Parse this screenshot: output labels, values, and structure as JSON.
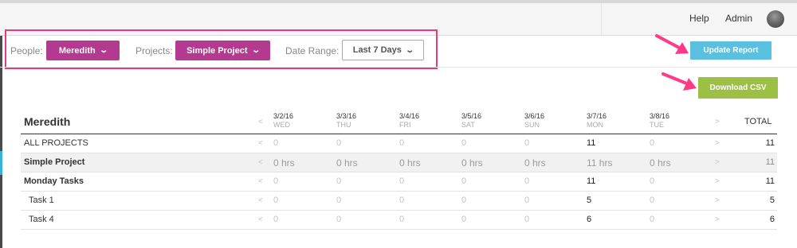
{
  "header": {
    "help": "Help",
    "admin": "Admin"
  },
  "filters": {
    "people_label": "People:",
    "people_value": "Meredith",
    "projects_label": "Projects:",
    "projects_value": "Simple Project",
    "date_label": "Date Range:",
    "date_value": "Last 7 Days"
  },
  "actions": {
    "update": "Update Report",
    "csv": "Download CSV"
  },
  "report": {
    "title": "Meredith",
    "prev": "<",
    "next": ">",
    "total_label": "TOTAL",
    "days": [
      {
        "date": "3/2/16",
        "day": "WED"
      },
      {
        "date": "3/3/16",
        "day": "THU"
      },
      {
        "date": "3/4/16",
        "day": "FRI"
      },
      {
        "date": "3/5/16",
        "day": "SAT"
      },
      {
        "date": "3/6/16",
        "day": "SUN"
      },
      {
        "date": "3/7/16",
        "day": "MON"
      },
      {
        "date": "3/8/16",
        "day": "TUE"
      }
    ],
    "rows": [
      {
        "label": "ALL PROJECTS",
        "values": [
          "0",
          "0",
          "0",
          "0",
          "0",
          "11",
          "0"
        ],
        "total": "11"
      },
      {
        "label": "Simple Project",
        "values": [
          "0 hrs",
          "0 hrs",
          "0 hrs",
          "0 hrs",
          "0 hrs",
          "11 hrs",
          "0 hrs"
        ],
        "total": "11"
      },
      {
        "label": "Monday Tasks",
        "values": [
          "0",
          "0",
          "0",
          "0",
          "0",
          "11",
          "0"
        ],
        "total": "11"
      },
      {
        "label": "Task 1",
        "values": [
          "0",
          "0",
          "0",
          "0",
          "0",
          "5",
          "0"
        ],
        "total": "5"
      },
      {
        "label": "Task 4",
        "values": [
          "0",
          "0",
          "0",
          "0",
          "0",
          "6",
          "0"
        ],
        "total": "6"
      }
    ]
  },
  "colors": {
    "pill": "#b33a8e",
    "update": "#5bbfdf",
    "csv": "#9cc043",
    "highlight": "#e83a7c"
  },
  "icons": [
    "chevron-down-icon",
    "avatar",
    "arrow-right-icon",
    "chevron-left-icon",
    "chevron-right-icon"
  ]
}
